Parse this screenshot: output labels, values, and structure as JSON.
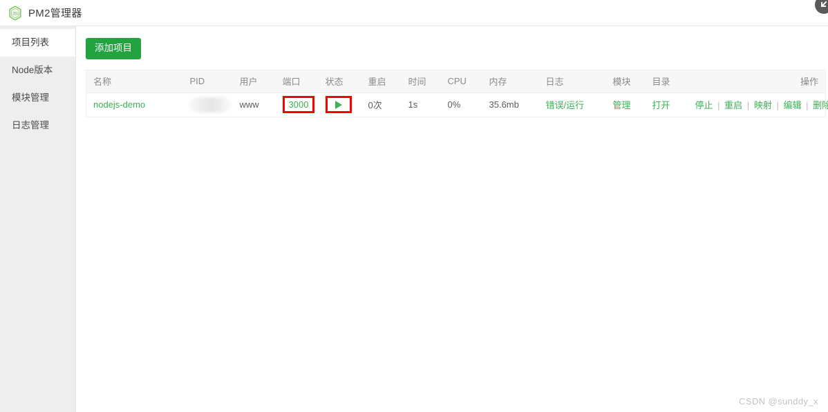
{
  "header": {
    "title": "PM2管理器",
    "logo_icon": "nodejs-hexagon-js-icon"
  },
  "sidebar": {
    "items": [
      {
        "label": "项目列表",
        "active": true
      },
      {
        "label": "Node版本",
        "active": false
      },
      {
        "label": "模块管理",
        "active": false
      },
      {
        "label": "日志管理",
        "active": false
      }
    ]
  },
  "toolbar": {
    "add_project_label": "添加项目"
  },
  "table": {
    "headers": {
      "name": "名称",
      "pid": "PID",
      "user": "用户",
      "port": "端口",
      "status": "状态",
      "restart": "重启",
      "time": "时间",
      "cpu": "CPU",
      "memory": "内存",
      "log": "日志",
      "module": "模块",
      "directory": "目录",
      "actions": "操作"
    },
    "rows": [
      {
        "name": "nodejs-demo",
        "pid": "",
        "user": "www",
        "port": "3000",
        "status_icon": "play-triangle-icon",
        "restart": "0次",
        "time": "1s",
        "cpu": "0%",
        "memory": "35.6mb",
        "log": "错误/运行",
        "module": "管理",
        "directory": "打开",
        "actions": [
          "停止",
          "重启",
          "映射",
          "编辑",
          "删除"
        ],
        "action_separator": "|"
      }
    ]
  },
  "annotations": {
    "highlight_color": "#fb0000",
    "highlighted_cells": [
      "port",
      "status"
    ]
  },
  "watermark": {
    "text": "CSDN @sunddy_x"
  },
  "colors": {
    "brand_green": "#22a33f",
    "link_green": "#3ab254",
    "sidebar_bg": "#eeeeee"
  }
}
